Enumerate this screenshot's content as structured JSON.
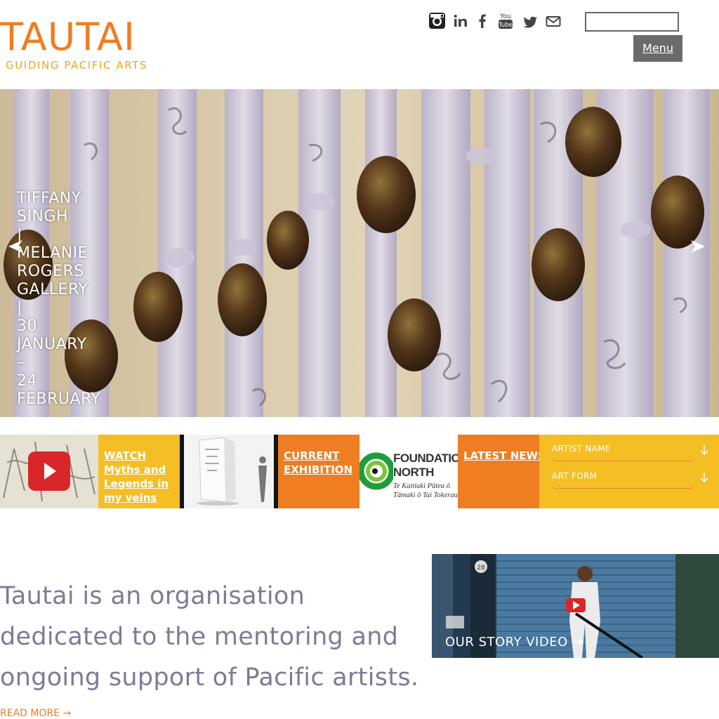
{
  "header": {
    "logo_text": "TAUTAI",
    "logo_tagline": "GUIDING PACIFIC ARTS",
    "menu_label": "Menu",
    "search_placeholder": ""
  },
  "social": [
    "instagram-icon",
    "linkedin-icon",
    "facebook-icon",
    "youtube-icon",
    "twitter-icon",
    "email-icon"
  ],
  "hero": {
    "caption_lines": [
      "TIFFANY",
      "SINGH",
      "|",
      "MELANIE",
      "ROGERS",
      "GALLERY",
      "|",
      "30",
      "JANUARY",
      "–",
      "24",
      "FEBRUARY"
    ]
  },
  "tiles": {
    "watch_label": "WATCH Myths and Legends in my veins",
    "exhibition_label": "CURRENT EXHIBITION",
    "foundation_name_1": "FOUNDATION",
    "foundation_name_2": "NORTH",
    "foundation_sub_1": "Te Kaitiaki Pūtea ō",
    "foundation_sub_2": "Tāmaki ō Tai Tokerau",
    "news_label": "LATEST NEWS",
    "filters": [
      "ARTIST NAME",
      "ART FORM"
    ]
  },
  "intro": {
    "text": "Tautai is an organisation dedicated to the mentoring and ongoing support of Pacific artists.",
    "read_more": "READ MORE →"
  },
  "video": {
    "label": "OUR STORY VIDEO →",
    "house_number": "28"
  },
  "colors": {
    "brand_orange": "#ef7d22",
    "brand_yellow": "#f5be25",
    "tagline_yellow": "#f0a323",
    "menu_gray": "#6b6b6b",
    "intro_text": "#7a7d95"
  }
}
